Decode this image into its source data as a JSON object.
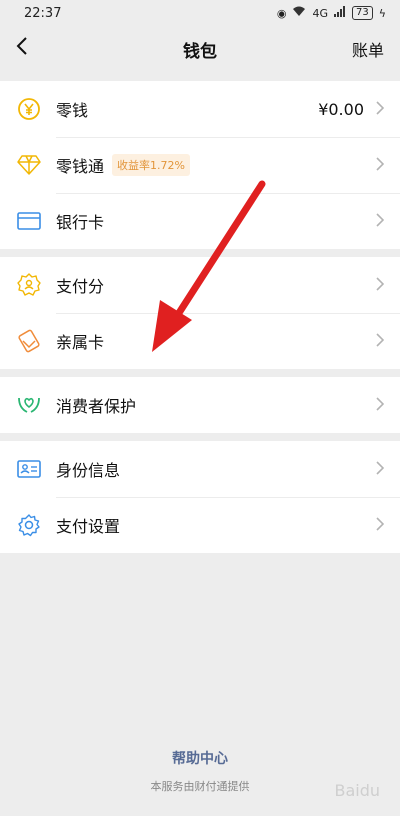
{
  "status": {
    "time": "22:37",
    "network": "4G",
    "battery": "73"
  },
  "nav": {
    "title": "钱包",
    "right": "账单"
  },
  "groups": [
    [
      {
        "name": "零钱",
        "value": "¥0.00",
        "icon": "yen-coin-icon"
      },
      {
        "name": "零钱通",
        "badge": "收益率1.72%",
        "icon": "diamond-icon"
      },
      {
        "name": "银行卡",
        "icon": "bank-card-icon"
      }
    ],
    [
      {
        "name": "支付分",
        "icon": "score-badge-icon"
      },
      {
        "name": "亲属卡",
        "icon": "family-card-icon"
      }
    ],
    [
      {
        "name": "消费者保护",
        "icon": "protect-hands-icon"
      }
    ],
    [
      {
        "name": "身份信息",
        "icon": "id-card-icon"
      },
      {
        "name": "支付设置",
        "icon": "gear-icon"
      }
    ]
  ],
  "footer": {
    "help": "帮助中心",
    "provided": "本服务由财付通提供"
  },
  "colors": {
    "arrow": "#e02020",
    "link": "#576b95",
    "badge_text": "#e2953a",
    "badge_bg": "#fdf0e0"
  }
}
